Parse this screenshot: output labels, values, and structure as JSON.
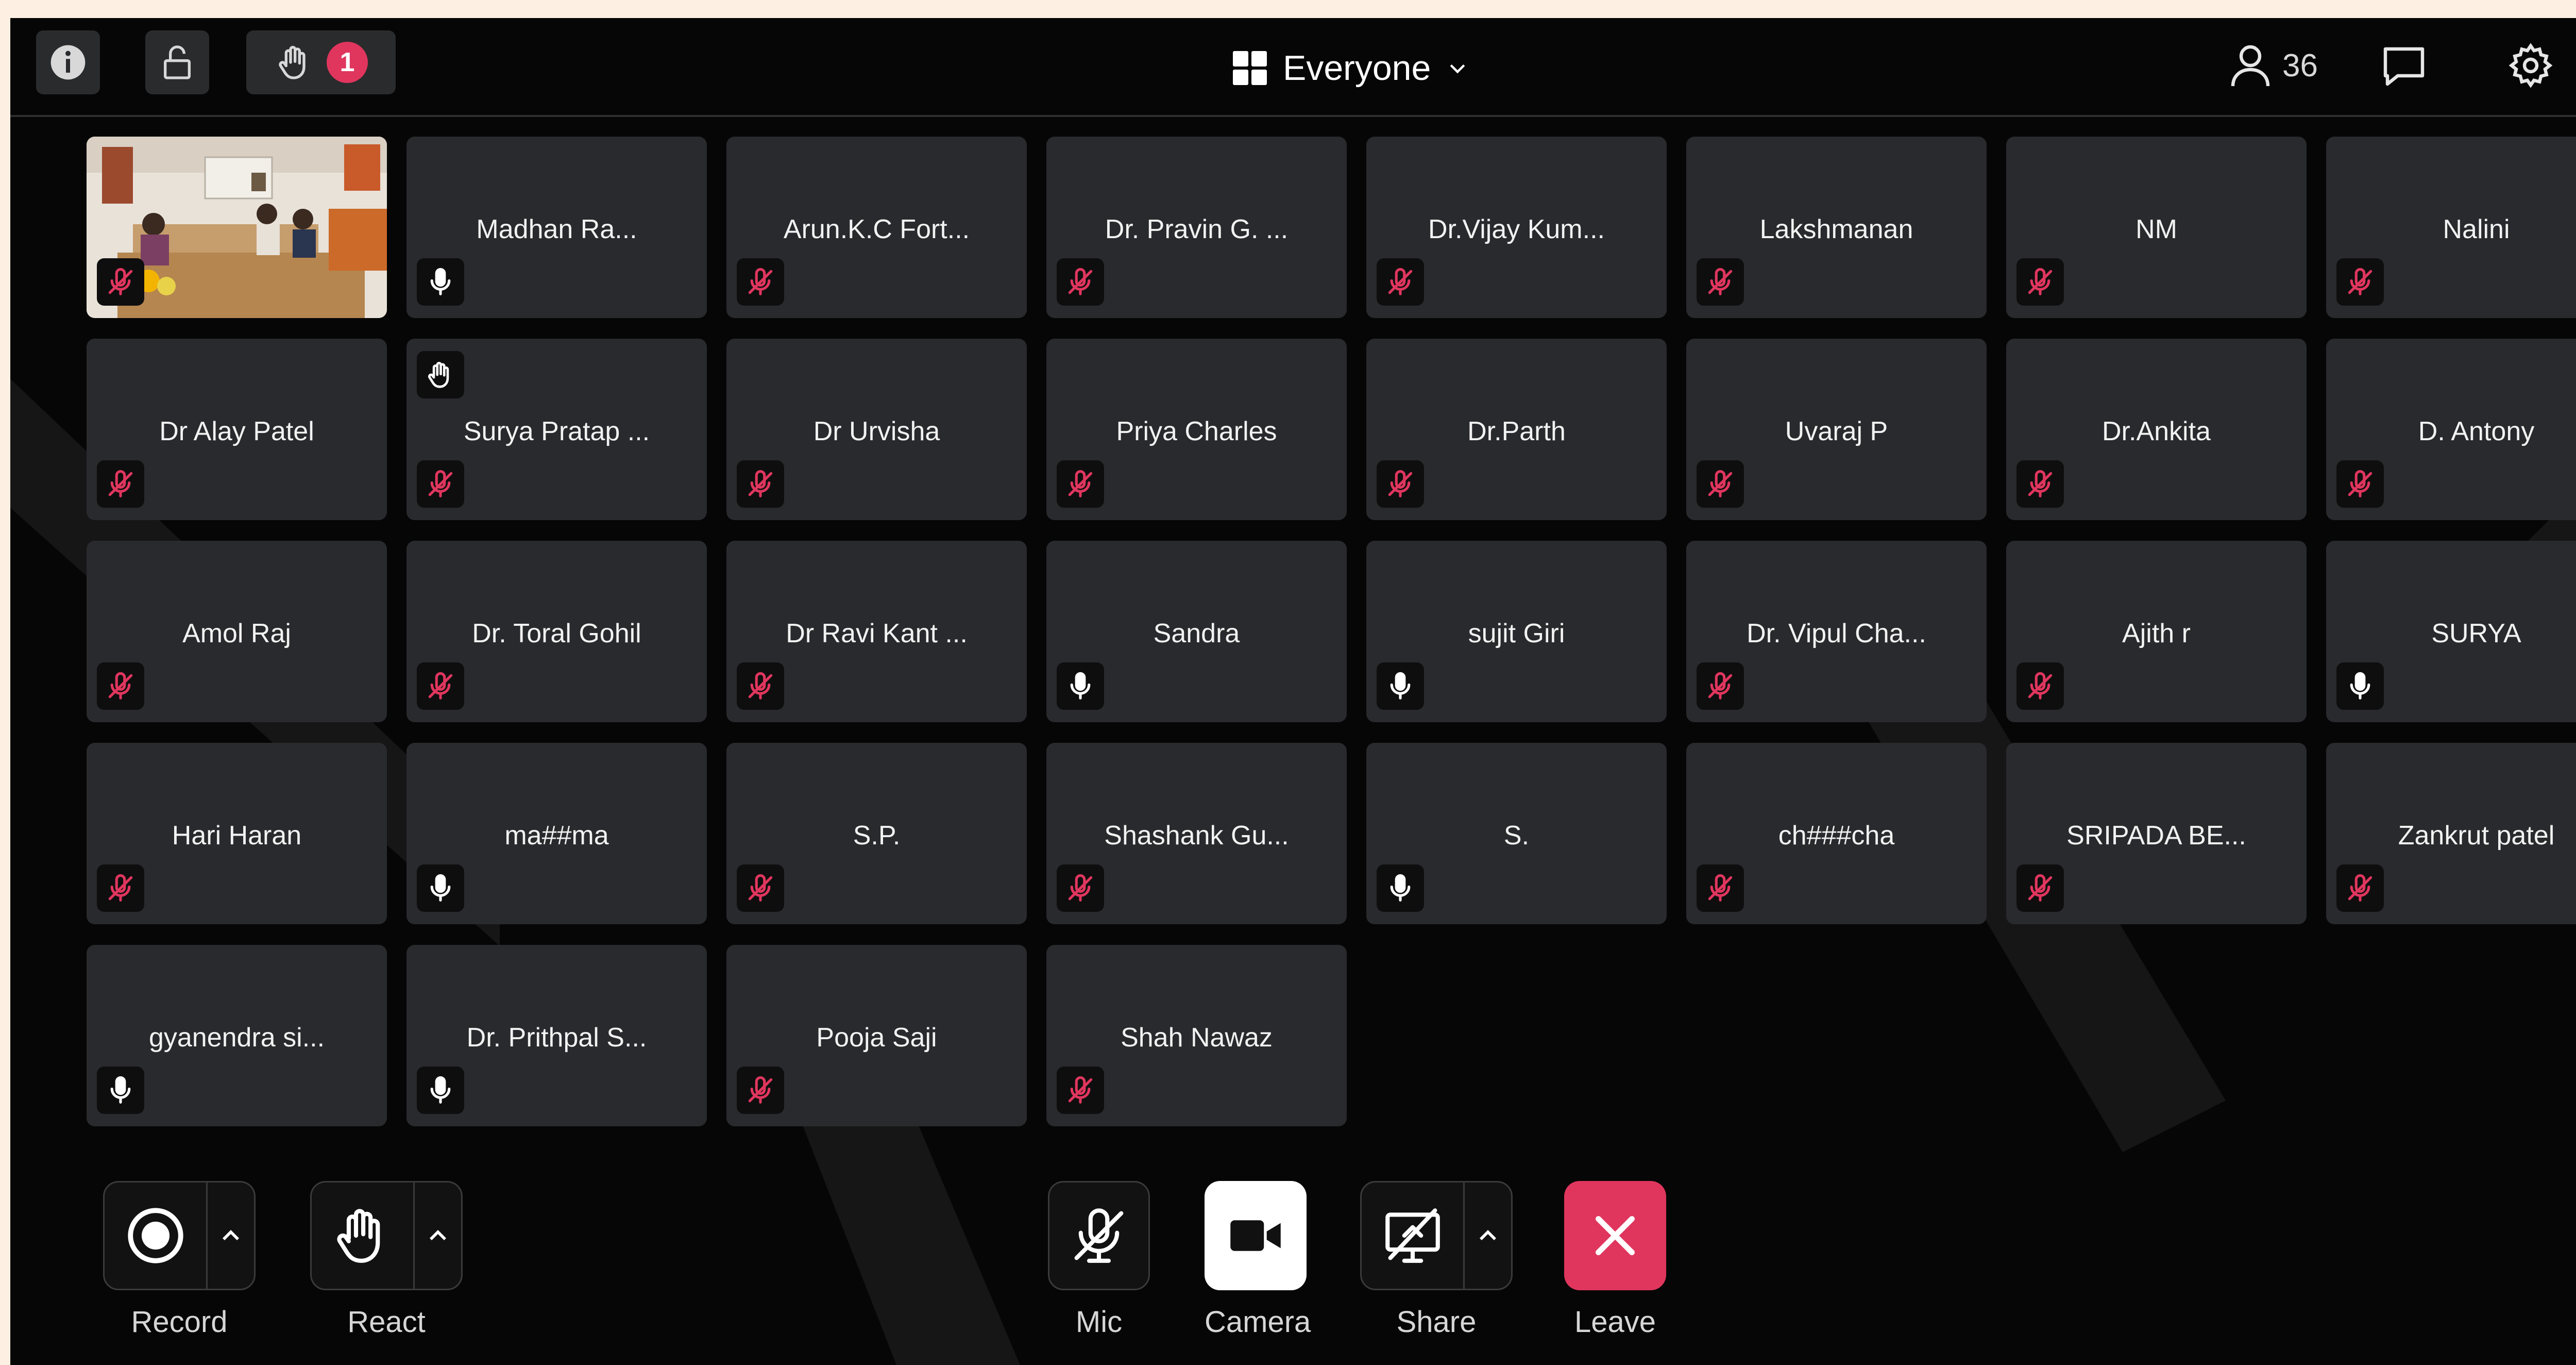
{
  "topbar": {
    "info_icon": "info-icon",
    "lock_icon": "lock-icon",
    "raised_hands_count": "1",
    "view_label": "Everyone",
    "participants_count": "36"
  },
  "tiles": [
    {
      "name": "",
      "mic": "muted",
      "video": true
    },
    {
      "name": "Madhan Ra...",
      "mic": "on"
    },
    {
      "name": "Arun.K.C Fort...",
      "mic": "muted"
    },
    {
      "name": "Dr. Pravin G. ...",
      "mic": "muted"
    },
    {
      "name": "Dr.Vijay Kum...",
      "mic": "muted"
    },
    {
      "name": "Lakshmanan",
      "mic": "muted"
    },
    {
      "name": "NM",
      "mic": "muted"
    },
    {
      "name": "Nalini",
      "mic": "muted"
    },
    {
      "name": "Dr Alay Patel",
      "mic": "muted"
    },
    {
      "name": "Surya Pratap ...",
      "mic": "muted",
      "hand": true
    },
    {
      "name": "Dr Urvisha",
      "mic": "muted"
    },
    {
      "name": "Priya Charles",
      "mic": "muted"
    },
    {
      "name": "Dr.Parth",
      "mic": "muted"
    },
    {
      "name": "Uvaraj P",
      "mic": "muted"
    },
    {
      "name": "Dr.Ankita",
      "mic": "muted"
    },
    {
      "name": "D. Antony",
      "mic": "muted"
    },
    {
      "name": "Amol Raj",
      "mic": "muted"
    },
    {
      "name": "Dr. Toral Gohil",
      "mic": "muted"
    },
    {
      "name": "Dr Ravi Kant ...",
      "mic": "muted"
    },
    {
      "name": "Sandra",
      "mic": "on"
    },
    {
      "name": "sujit Giri",
      "mic": "on"
    },
    {
      "name": "Dr. Vipul Cha...",
      "mic": "muted"
    },
    {
      "name": "Ajith r",
      "mic": "muted"
    },
    {
      "name": "SURYA",
      "mic": "on"
    },
    {
      "name": "Hari Haran",
      "mic": "muted"
    },
    {
      "name": "ma##ma",
      "mic": "on"
    },
    {
      "name": "S.P.",
      "mic": "muted"
    },
    {
      "name": "Shashank Gu...",
      "mic": "muted"
    },
    {
      "name": "S.",
      "mic": "on"
    },
    {
      "name": "ch###cha",
      "mic": "muted"
    },
    {
      "name": "SRIPADA BE...",
      "mic": "muted"
    },
    {
      "name": "Zankrut patel",
      "mic": "muted"
    },
    {
      "name": "gyanendra si...",
      "mic": "on"
    },
    {
      "name": "Dr. Prithpal S...",
      "mic": "on"
    },
    {
      "name": "Pooja Saji",
      "mic": "muted"
    },
    {
      "name": "Shah Nawaz",
      "mic": "muted"
    }
  ],
  "controls": {
    "record_label": "Record",
    "react_label": "React",
    "mic_label": "Mic",
    "camera_label": "Camera",
    "share_label": "Share",
    "leave_label": "Leave"
  },
  "colors": {
    "background": "#060606",
    "tile": "#292a2d",
    "muted_mic": "#e0365e",
    "leave_button": "#e0365e",
    "camera_button": "#ffffff"
  }
}
